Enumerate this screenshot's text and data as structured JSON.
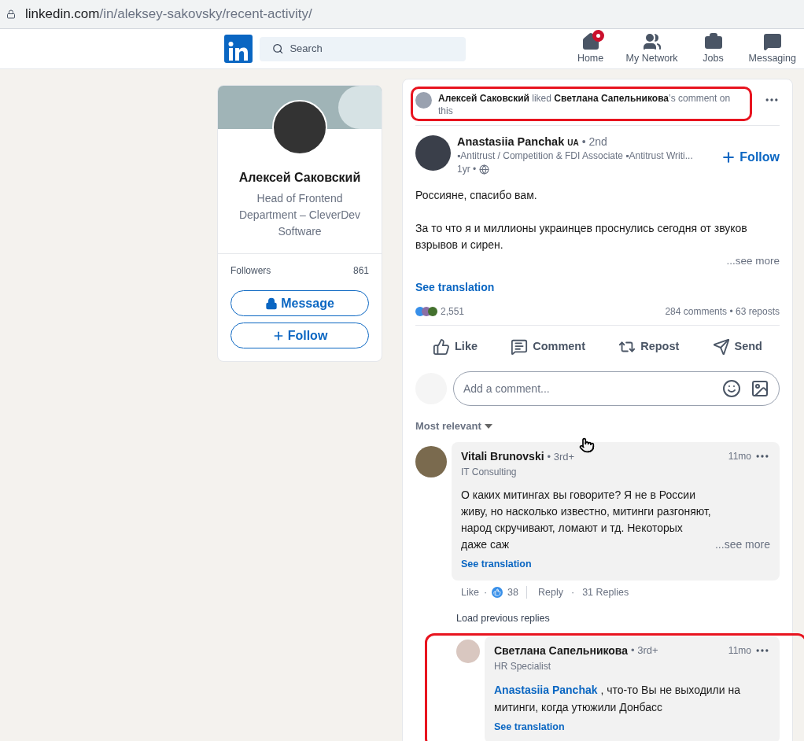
{
  "address_bar": {
    "url_host": "linkedin.com",
    "url_path": "/in/aleksey-sakovsky/recent-activity/"
  },
  "nav": {
    "search": {
      "placeholder": "Search"
    },
    "items": [
      {
        "label": "Home",
        "kind": "home",
        "notification": true
      },
      {
        "label": "My Network",
        "kind": "network",
        "notification": false
      },
      {
        "label": "Jobs",
        "kind": "jobs",
        "notification": false
      },
      {
        "label": "Messaging",
        "kind": "messaging",
        "notification": false
      }
    ]
  },
  "profile": {
    "name": "Алексей Саковский",
    "headline": "Head of Frontend Department – CleverDev Software",
    "followers_label": "Followers",
    "followers_count": "861",
    "buttons": [
      {
        "label": "Message",
        "kind": "lock"
      },
      {
        "label": "Follow",
        "kind": "plus"
      }
    ]
  },
  "post": {
    "activity": {
      "text": "**Алексей Саковский** liked **Светлана Сапельникова**’s comment on this",
      "highlighted": true
    },
    "author": {
      "name": "Anastasiia Panchak",
      "flag": "UA",
      "degree": "• 2nd",
      "headline": "▪Antitrust / Competition & FDI Associate ▪Antitrust Writi...",
      "time": "1yr •"
    },
    "follow": "Follow",
    "body": [
      "Россияне, спасибо вам.",
      "За то что я и миллионы украинцев проснулись сегодня от звуков взрывов и сирен."
    ],
    "see_more": "...see more",
    "see_translation": "See translation",
    "reactions_count": "2,551",
    "stats": "284 comments • 63 reposts",
    "actions": [
      {
        "label": "Like",
        "kind": "like"
      },
      {
        "label": "Comment",
        "kind": "comment"
      },
      {
        "label": "Repost",
        "kind": "repost"
      },
      {
        "label": "Send",
        "kind": "send"
      }
    ],
    "comment_field": {
      "placeholder": "Add a comment..."
    },
    "sort": "Most relevant",
    "comment": {
      "name": "Vitali Brunovski",
      "degree": "• 3rd+",
      "headline": "IT Consulting",
      "time": "11mo",
      "text": "О каких митингах вы говорите? Я не в России живу, но насколько известно, митинги разгоняют, народ скручивают, ломают и тд. Некоторых даже саж",
      "see_more": "...see more",
      "see_translation": "See translation",
      "like": "Like",
      "separator": "·",
      "like_count": "38",
      "reply": "Reply",
      "replies": "31 Replies"
    },
    "load_previous": "Load previous replies",
    "reply": {
      "name": "Светлана Сапельникова",
      "degree": "• 3rd+",
      "headline": "HR Specialist",
      "time": "11mo",
      "mention": "Anastasiia Panchak",
      "text": ", что-то Вы не выходили на митинги, когда утюжили Донбасс",
      "see_translation": "See translation",
      "highlighted": true
    }
  }
}
